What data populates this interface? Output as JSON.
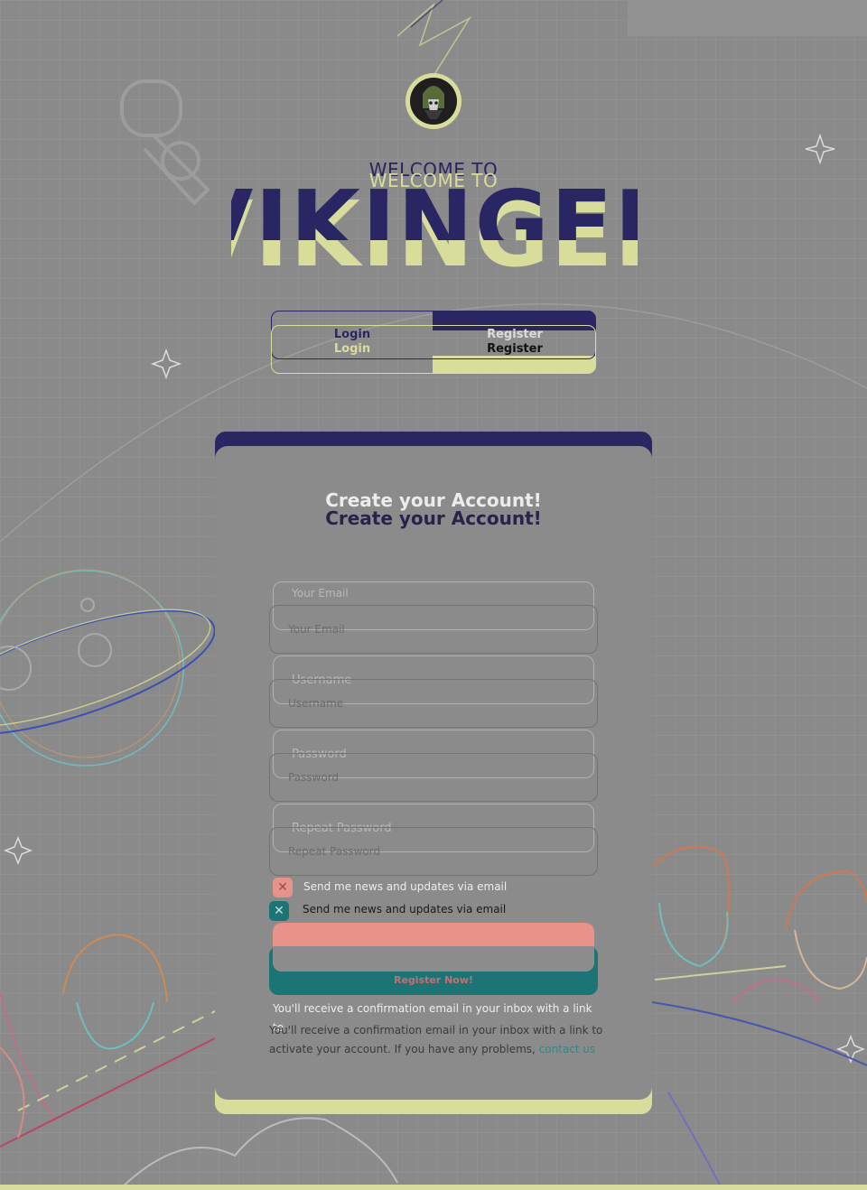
{
  "app": {
    "welcome_text": "WELCOME TO",
    "brand_name": "VIKINGER"
  },
  "tabs": {
    "login_label": "Login",
    "register_label": "Register",
    "active": "register"
  },
  "form": {
    "title": "Create your Account!",
    "email_placeholder": "Your Email",
    "username_placeholder": "Username",
    "password_placeholder": "Password",
    "repeat_password_placeholder": "Repeat Password",
    "newsletter_label": "Send me news and updates via email",
    "newsletter_checked": true,
    "submit_label": "Register Now!",
    "note_text": "You'll receive a confirmation email in your inbox with a link to activate your account. If you have any problems,",
    "note_line1": "You'll receive a confirmation email in your inbox with a link to",
    "note_line2": "activate your account. If you have any problems,",
    "contact_link": "contact us"
  },
  "colors": {
    "background": "#8a8a8a",
    "primary_dark": "#2a2563",
    "accent_yellow": "#d8dd9c",
    "accent_pink": "#e9928a",
    "accent_teal": "#1d7474",
    "link": "#2a8a8a"
  },
  "icons": {
    "logo": "viking-helmet-logo",
    "checkbox": "x-mark-icon"
  }
}
